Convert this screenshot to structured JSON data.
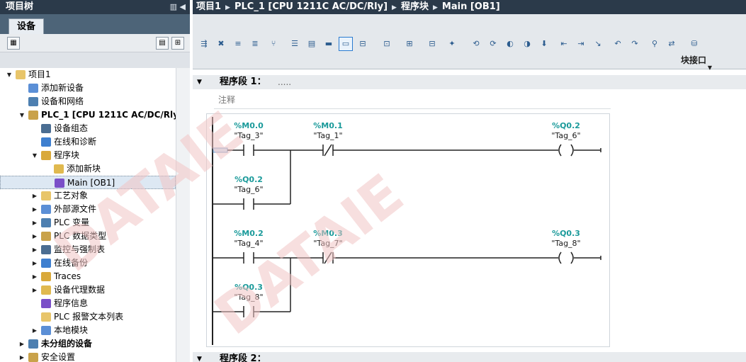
{
  "project_tree": {
    "title": "项目树",
    "title_icons": "▥ ◀",
    "tab_devices": "设备",
    "items": [
      {
        "label": "项目1",
        "level": 0,
        "expanded": true,
        "bold": false
      },
      {
        "label": "添加新设备",
        "level": 1,
        "bold": false
      },
      {
        "label": "设备和网络",
        "level": 1,
        "bold": false
      },
      {
        "label": "PLC_1 [CPU 1211C AC/DC/Rly]",
        "level": 1,
        "expanded": true,
        "bold": true
      },
      {
        "label": "设备组态",
        "level": 2,
        "bold": false
      },
      {
        "label": "在线和诊断",
        "level": 2,
        "bold": false
      },
      {
        "label": "程序块",
        "level": 2,
        "expanded": true,
        "bold": false
      },
      {
        "label": "添加新块",
        "level": 3,
        "bold": false
      },
      {
        "label": "Main [OB1]",
        "level": 3,
        "bold": false,
        "selected": true
      },
      {
        "label": "工艺对象",
        "level": 2,
        "collapsed": true,
        "bold": false
      },
      {
        "label": "外部源文件",
        "level": 2,
        "collapsed": true,
        "bold": false
      },
      {
        "label": "PLC 变量",
        "level": 2,
        "collapsed": true,
        "bold": false
      },
      {
        "label": "PLC 数据类型",
        "level": 2,
        "collapsed": true,
        "bold": false
      },
      {
        "label": "监控与强制表",
        "level": 2,
        "collapsed": true,
        "bold": false
      },
      {
        "label": "在线备份",
        "level": 2,
        "collapsed": true,
        "bold": false
      },
      {
        "label": "Traces",
        "level": 2,
        "collapsed": true,
        "bold": false
      },
      {
        "label": "设备代理数据",
        "level": 2,
        "collapsed": true,
        "bold": false
      },
      {
        "label": "程序信息",
        "level": 2,
        "bold": false
      },
      {
        "label": "PLC 报警文本列表",
        "level": 2,
        "bold": false
      },
      {
        "label": "本地模块",
        "level": 2,
        "collapsed": true,
        "bold": false
      },
      {
        "label": "未分组的设备",
        "level": 1,
        "collapsed": true,
        "bold": true
      },
      {
        "label": "安全设置",
        "level": 1,
        "collapsed": true,
        "bold": false
      }
    ]
  },
  "breadcrumb": {
    "items": [
      "项目1",
      "PLC_1 [CPU 1211C AC/DC/Rly]",
      "程序块",
      "Main [OB1]"
    ]
  },
  "editor": {
    "block_interface_label": "块接口",
    "network1": {
      "title": "程序段 1：",
      "dots": ".....",
      "comment": "注释"
    },
    "network2": {
      "title": "程序段 2："
    }
  },
  "ladder": {
    "rung1": [
      {
        "address": "%M0.0",
        "tag": "\"Tag_3\"",
        "kind": "NO"
      },
      {
        "address": "%M0.1",
        "tag": "\"Tag_1\"",
        "kind": "NC"
      },
      {
        "address": "%Q0.2",
        "tag": "\"Tag_6\"",
        "kind": "COIL"
      },
      {
        "address": "%Q0.2",
        "tag": "\"Tag_6\"",
        "kind": "NO-branch"
      }
    ],
    "rung2": [
      {
        "address": "%M0.2",
        "tag": "\"Tag_4\"",
        "kind": "NO"
      },
      {
        "address": "%M0.3",
        "tag": "\"Tag_7\"",
        "kind": "NC"
      },
      {
        "address": "%Q0.3",
        "tag": "\"Tag_8\"",
        "kind": "COIL"
      },
      {
        "address": "%Q0.3",
        "tag": "\"Tag_8\"",
        "kind": "NO-branch"
      }
    ]
  },
  "watermark": {
    "text1": "DATAIE",
    "text2": "DATAIE"
  },
  "colors": {
    "titlebar": "#2b3a4a",
    "address": "#1a9a9a",
    "tree_selected": "#dde8f3"
  }
}
